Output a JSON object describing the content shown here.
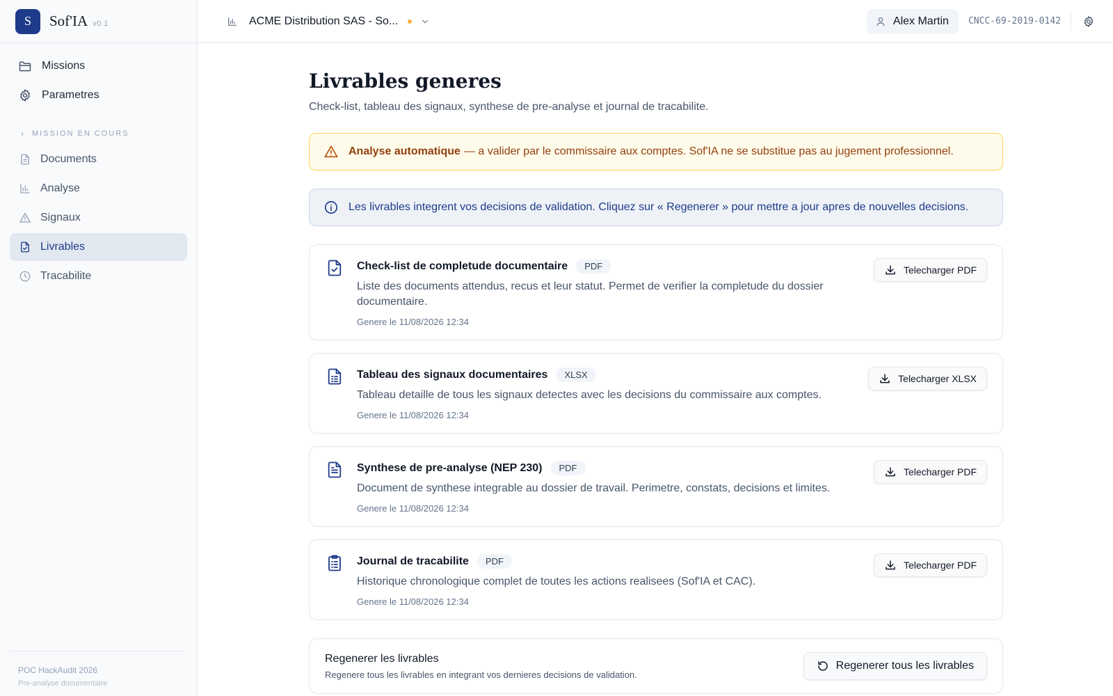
{
  "brand": {
    "logo_letter": "S",
    "name": "Sof'IA",
    "version": "v0.1"
  },
  "sidebar": {
    "main_items": [
      {
        "label": "Missions",
        "icon": "folder-icon"
      },
      {
        "label": "Parametres",
        "icon": "gear-icon"
      }
    ],
    "section_label": "MISSION EN COURS",
    "mission_items": [
      {
        "label": "Documents",
        "icon": "document-icon"
      },
      {
        "label": "Analyse",
        "icon": "bar-chart-icon"
      },
      {
        "label": "Signaux",
        "icon": "warning-icon"
      },
      {
        "label": "Livrables",
        "icon": "file-check-icon",
        "active": true
      },
      {
        "label": "Tracabilite",
        "icon": "clock-icon"
      }
    ],
    "footer": {
      "line1": "POC HackAudit 2026",
      "line2": "Pre-analyse documentaire"
    }
  },
  "topbar": {
    "mission_name": "ACME Distribution SAS - So...",
    "user_name": "Alex Martin",
    "cncc_id": "CNCC-69-2019-0142"
  },
  "page": {
    "title": "Livrables generes",
    "subtitle": "Check-list, tableau des signaux, synthese de pre-analyse et journal de tracabilite."
  },
  "alerts": {
    "warning_bold": "Analyse automatique",
    "warning_text": "— a valider par le commissaire aux comptes. Sof'IA ne se substitue pas au jugement professionnel.",
    "info_text": "Les livrables integrent vos decisions de validation. Cliquez sur « Regenerer » pour mettre a jour apres de nouvelles decisions."
  },
  "deliverables": [
    {
      "title": "Check-list de completude documentaire",
      "format": "PDF",
      "description": "Liste des documents attendus, recus et leur statut. Permet de verifier la completude du dossier documentaire.",
      "generated": "Genere le 11/08/2026 12:34",
      "button": "Telecharger PDF",
      "icon": "file-check-icon"
    },
    {
      "title": "Tableau des signaux documentaires",
      "format": "XLSX",
      "description": "Tableau detaille de tous les signaux detectes avec les decisions du commissaire aux comptes.",
      "generated": "Genere le 11/08/2026 12:34",
      "button": "Telecharger XLSX",
      "icon": "file-spreadsheet-icon"
    },
    {
      "title": "Synthese de pre-analyse (NEP 230)",
      "format": "PDF",
      "description": "Document de synthese integrable au dossier de travail. Perimetre, constats, decisions et limites.",
      "generated": "Genere le 11/08/2026 12:34",
      "button": "Telecharger PDF",
      "icon": "file-text-icon"
    },
    {
      "title": "Journal de tracabilite",
      "format": "PDF",
      "description": "Historique chronologique complet de toutes les actions realisees (Sof'IA et CAC).",
      "generated": "Genere le 11/08/2026 12:34",
      "button": "Telecharger PDF",
      "icon": "clipboard-list-icon"
    }
  ],
  "regen": {
    "title": "Regenerer les livrables",
    "description": "Regenere tous les livrables en integrant vos dernieres decisions de validation.",
    "button": "Regenerer tous les livrables"
  },
  "colors": {
    "brand": "#1e3a8a",
    "warning_bg": "#fffbeb",
    "warning_border": "#fcd34d",
    "warning_text": "#92400e",
    "info_bg": "#eef2f7",
    "status_dot": "#f59e0b"
  }
}
